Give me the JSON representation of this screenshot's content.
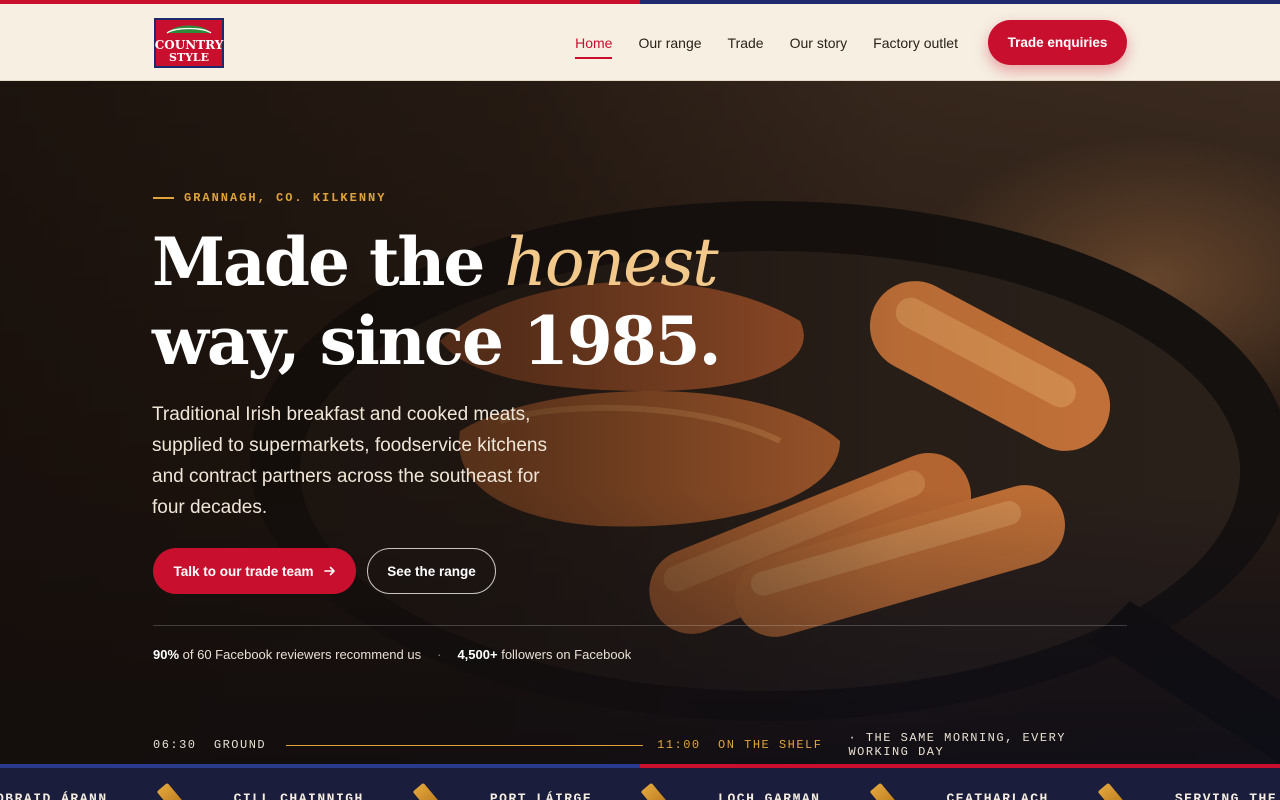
{
  "brand": {
    "logo_text_line1": "COUNTRY",
    "logo_text_line2": "STYLE",
    "colors": {
      "red": "#c8102e",
      "navy": "#1e2a6b",
      "gold": "#e0a33a",
      "cream": "#f6efe2"
    }
  },
  "nav": {
    "items": [
      {
        "label": "Home",
        "active": true
      },
      {
        "label": "Our range",
        "active": false
      },
      {
        "label": "Trade",
        "active": false
      },
      {
        "label": "Our story",
        "active": false
      },
      {
        "label": "Factory outlet",
        "active": false
      }
    ],
    "cta_label": "Trade enquiries"
  },
  "hero": {
    "eyebrow": "GRANNAGH, CO. KILKENNY",
    "headline_part1": "Made the ",
    "headline_accent": "honest",
    "headline_part2": "way, since 1985.",
    "lede": "Traditional Irish breakfast and cooked meats, supplied to supermarkets, foodservice kitchens and contract partners across the southeast for four decades.",
    "primary_button": "Talk to our trade team",
    "primary_button_icon": "arrow-right-icon",
    "secondary_button": "See the range",
    "proof": {
      "stat1_value": "90%",
      "stat1_text": "of 60 Facebook reviewers recommend us",
      "separator": "·",
      "stat2_value": "4,500+",
      "stat2_text": "followers on Facebook"
    },
    "timeline": {
      "start": "06:30  GROUND",
      "end": "11:00  ON THE SHELF",
      "note": "· THE SAME MORNING, EVERY WORKING DAY"
    }
  },
  "ticker": {
    "items": [
      "OBRAID ÁRANN",
      "CILL CHAINNIGH",
      "PORT LÁIRGE",
      "LOCH GARMAN",
      "CEATHARLACH",
      "SERVING THE SOUTHEAST"
    ],
    "separator_icon": "sausage-icon"
  }
}
